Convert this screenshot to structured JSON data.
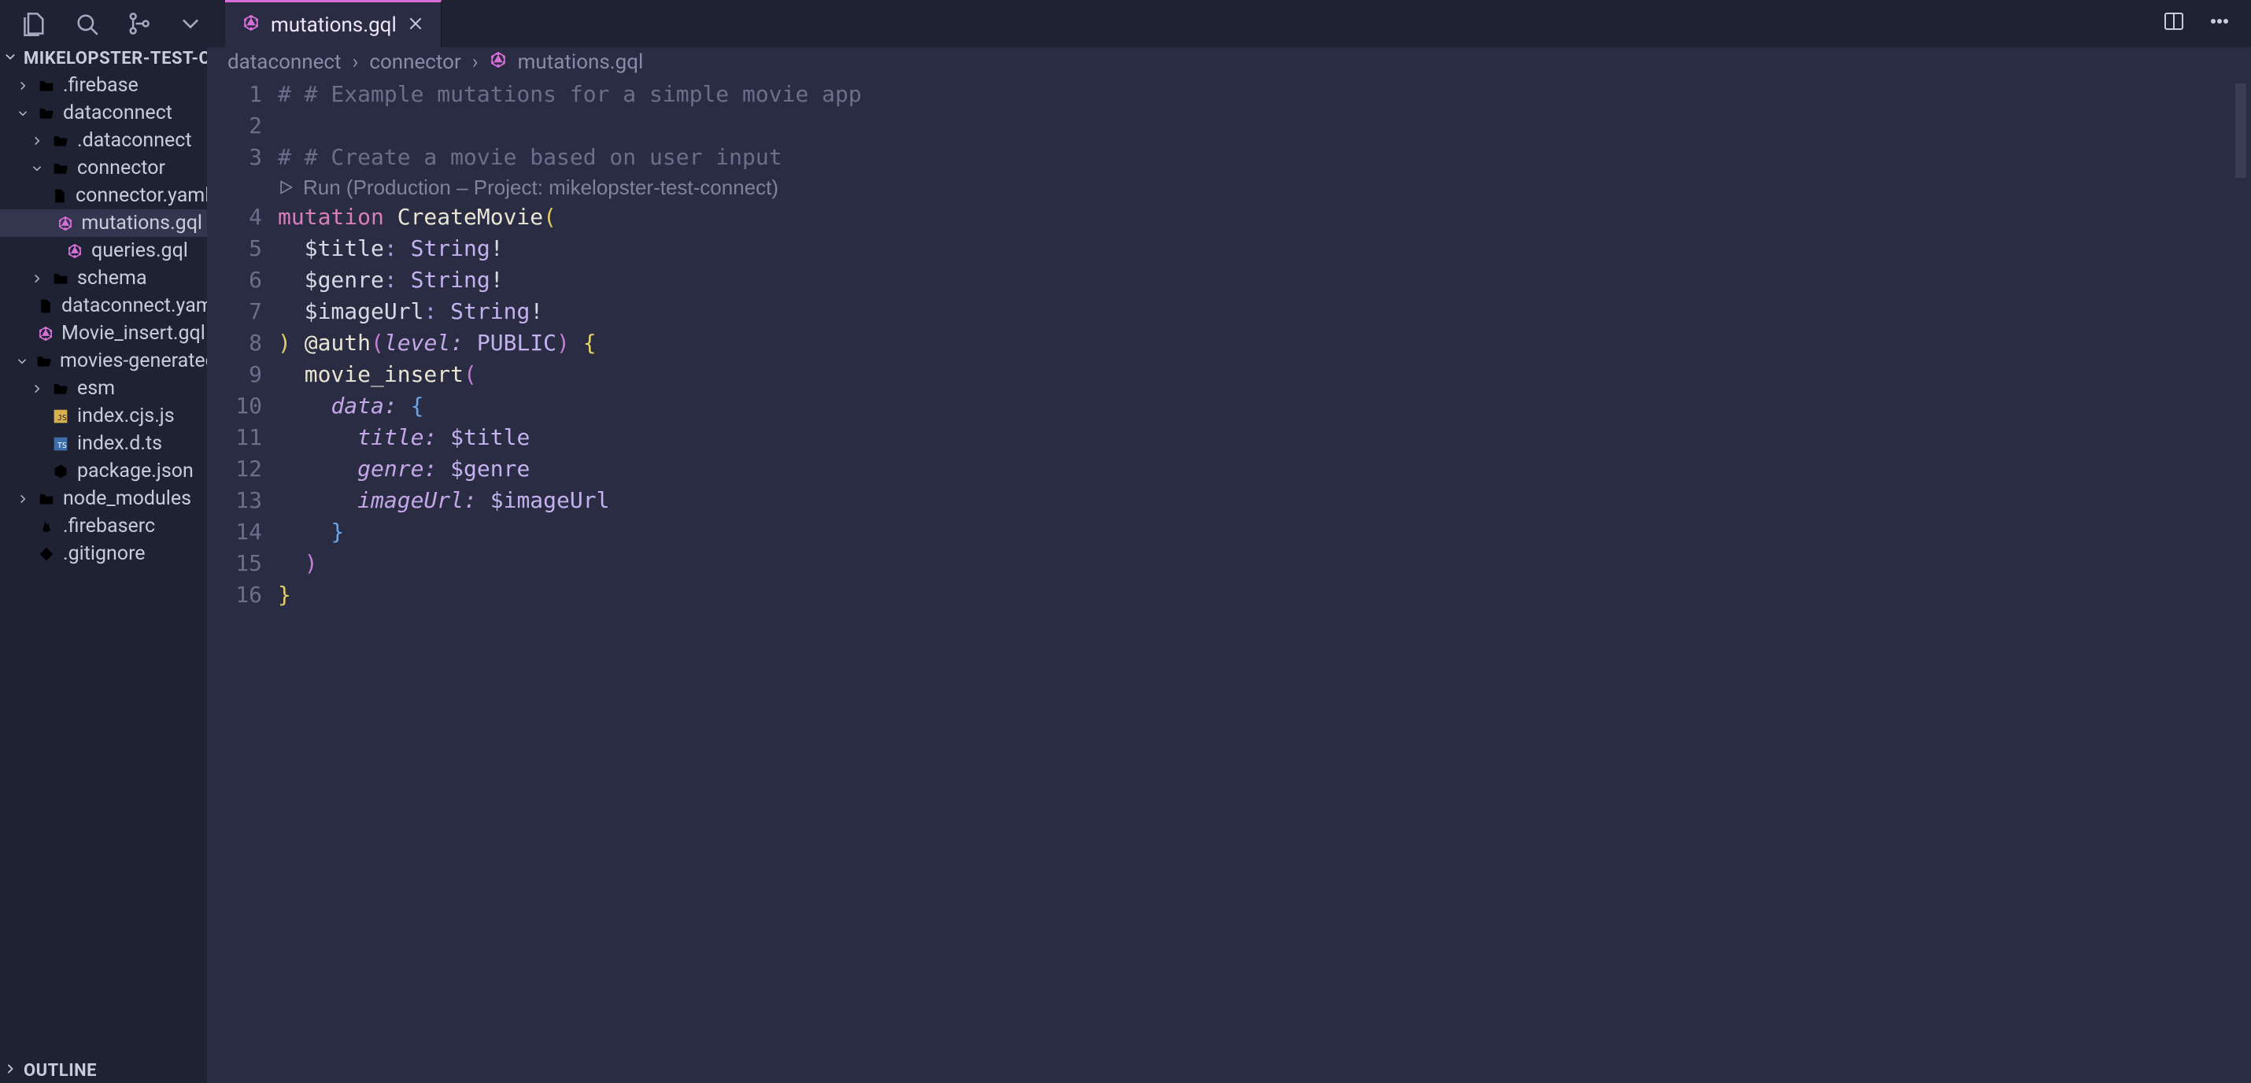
{
  "top": {
    "icons": [
      "files-icon",
      "search-icon",
      "source-control-icon",
      "chevron-down-icon"
    ],
    "right_icons": [
      "split-editor-icon",
      "more-icon"
    ]
  },
  "tab": {
    "label": "mutations.gql"
  },
  "sidebar": {
    "header": "MIKELOPSTER-TEST-CO...",
    "items": [
      {
        "depth": 0,
        "chev": "right",
        "icon": "folder-yellow",
        "label": ".firebase"
      },
      {
        "depth": 0,
        "chev": "down",
        "icon": "folder-grey",
        "label": "dataconnect"
      },
      {
        "depth": 1,
        "chev": "right",
        "icon": "folder-grey",
        "label": ".dataconnect"
      },
      {
        "depth": 1,
        "chev": "down",
        "icon": "folder-grey",
        "label": "connector"
      },
      {
        "depth": 2,
        "chev": "",
        "icon": "file-red",
        "label": "connector.yaml"
      },
      {
        "depth": 2,
        "chev": "",
        "icon": "gql",
        "label": "mutations.gql",
        "selected": true
      },
      {
        "depth": 2,
        "chev": "",
        "icon": "gql",
        "label": "queries.gql"
      },
      {
        "depth": 1,
        "chev": "right",
        "icon": "folder-red",
        "label": "schema"
      },
      {
        "depth": 1,
        "chev": "",
        "icon": "file-red",
        "label": "dataconnect.yaml"
      },
      {
        "depth": 1,
        "chev": "",
        "icon": "gql",
        "label": "Movie_insert.gql"
      },
      {
        "depth": 0,
        "chev": "down",
        "icon": "folder-grey",
        "label": "movies-generated"
      },
      {
        "depth": 1,
        "chev": "right",
        "icon": "folder-grey",
        "label": "esm"
      },
      {
        "depth": 1,
        "chev": "",
        "icon": "js",
        "label": "index.cjs.js"
      },
      {
        "depth": 1,
        "chev": "",
        "icon": "ts",
        "label": "index.d.ts"
      },
      {
        "depth": 1,
        "chev": "",
        "icon": "node",
        "label": "package.json"
      },
      {
        "depth": 0,
        "chev": "right",
        "icon": "folder-green",
        "label": "node_modules"
      },
      {
        "depth": 0,
        "chev": "",
        "icon": "fire",
        "label": ".firebaserc"
      },
      {
        "depth": 0,
        "chev": "",
        "icon": "git",
        "label": ".gitignore"
      }
    ],
    "outline": "OUTLINE"
  },
  "breadcrumbs": {
    "seg0": "dataconnect",
    "seg1": "connector",
    "seg2": "mutations.gql"
  },
  "codelens": "Run (Production – Project: mikelopster-test-connect)",
  "code": {
    "l1": "# # Example mutations for a simple movie app",
    "l3": "# # Create a movie based on user input",
    "l4_kw": "mutation",
    "l4_id": "CreateMovie",
    "l5_v": "$title",
    "l5_t": "String",
    "l6_v": "$genre",
    "l6_t": "String",
    "l7_v": "$imageUrl",
    "l7_t": "String",
    "l8_dir": "@auth",
    "l8_pk": "level:",
    "l8_cn": "PUBLIC",
    "l9": "movie_insert",
    "l10": "data:",
    "l11k": "title:",
    "l11v": "$title",
    "l12k": "genre:",
    "l12v": "$genre",
    "l13k": "imageUrl:",
    "l13v": "$imageUrl"
  },
  "line_numbers": [
    "1",
    "2",
    "3",
    "4",
    "5",
    "6",
    "7",
    "8",
    "9",
    "10",
    "11",
    "12",
    "13",
    "14",
    "15",
    "16"
  ]
}
